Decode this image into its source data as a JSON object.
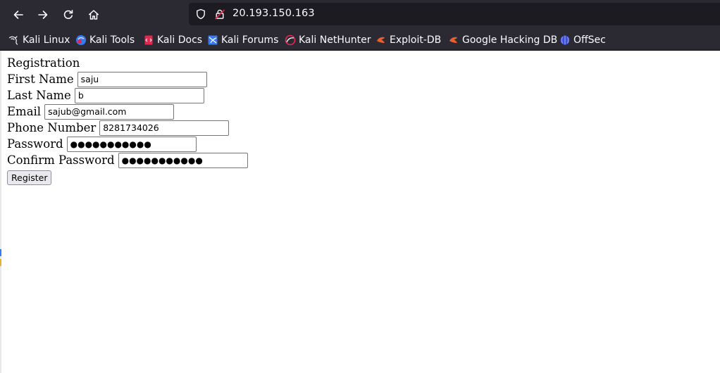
{
  "browser": {
    "url": "20.193.150.163",
    "bookmarks": [
      {
        "label": "Kali Linux",
        "icon": "kali-dragon-icon"
      },
      {
        "label": "Kali Tools",
        "icon": "kali-tools-icon"
      },
      {
        "label": "Kali Docs",
        "icon": "kali-docs-icon"
      },
      {
        "label": "Kali Forums",
        "icon": "kali-forums-icon"
      },
      {
        "label": "Kali NetHunter",
        "icon": "kali-nethunter-icon"
      },
      {
        "label": "Exploit-DB",
        "icon": "exploit-db-icon"
      },
      {
        "label": "Google Hacking DB",
        "icon": "google-hacking-db-icon"
      },
      {
        "label": "OffSec",
        "icon": "offsec-icon"
      }
    ]
  },
  "form": {
    "heading": "Registration",
    "first_name": {
      "label": "First Name",
      "value": "saju"
    },
    "last_name": {
      "label": "Last Name",
      "value": "b"
    },
    "email": {
      "label": "Email",
      "value": "sajub@gmail.com"
    },
    "phone": {
      "label": "Phone Number",
      "value": "8281734026"
    },
    "password": {
      "label": "Password",
      "value": "●●●●●●●●●●●"
    },
    "confirm_password": {
      "label": "Confirm Password",
      "value": "●●●●●●●●●●●"
    },
    "submit_label": "Register"
  },
  "colors": {
    "chrome_bg": "#2b2a33",
    "urlbar_bg": "#1c1b22",
    "chrome_text": "#fbfbfe",
    "button_bg": "#e9e9ed"
  }
}
